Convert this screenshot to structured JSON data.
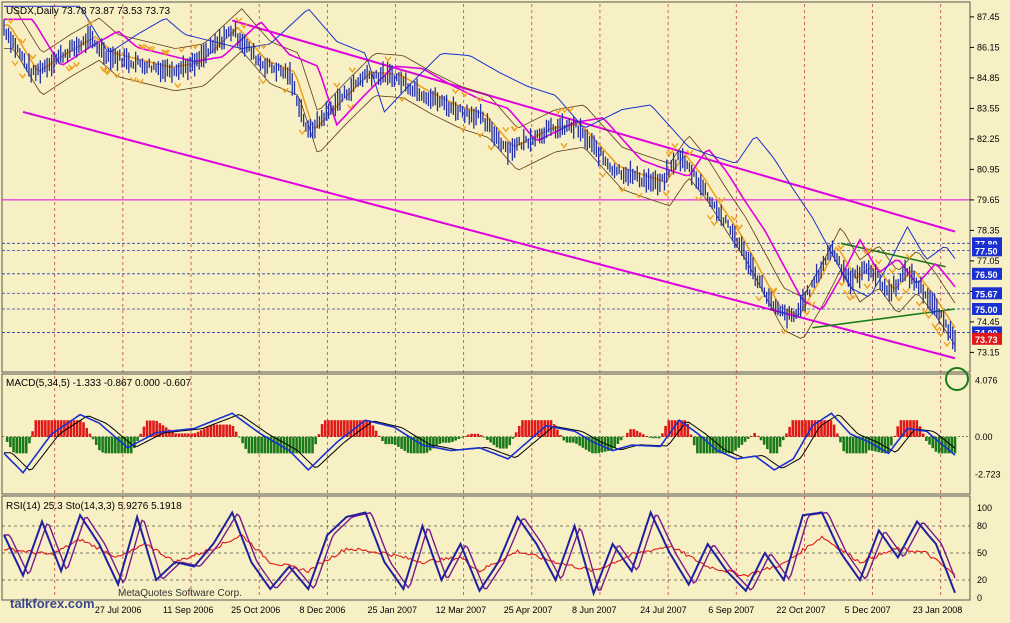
{
  "chart_data": [
    {
      "type": "line",
      "panel": "price",
      "header": "USDX,Daily  73.78 73.87 73.53 73.73",
      "symbol": "USDX",
      "timeframe": "Daily",
      "ohlc": {
        "open": 73.78,
        "high": 73.87,
        "low": 73.53,
        "close": 73.73
      },
      "y_ticks": [
        "87.45",
        "86.15",
        "84.85",
        "83.55",
        "82.25",
        "80.95",
        "79.65",
        "78.35",
        "77.05",
        "75.75",
        "74.45",
        "73.15"
      ],
      "ylim": [
        72.4,
        88.0
      ],
      "price_labels": [
        {
          "text": "77.80",
          "value": 77.8
        },
        {
          "text": "77.50",
          "value": 77.5
        },
        {
          "text": "76.50",
          "value": 76.5
        },
        {
          "text": "75.67",
          "value": 75.67
        },
        {
          "text": "75.00",
          "value": 75.0
        },
        {
          "text": "74.00",
          "value": 74.0
        },
        {
          "text": "73.73",
          "value": 73.73
        }
      ],
      "horizontal_levels": [
        79.65,
        77.8,
        77.5,
        76.5,
        75.67,
        75.0,
        74.0
      ],
      "close_path": [
        [
          0,
          87.0
        ],
        [
          0.03,
          85.0
        ],
        [
          0.06,
          85.8
        ],
        [
          0.09,
          86.5
        ],
        [
          0.11,
          85.8
        ],
        [
          0.14,
          85.5
        ],
        [
          0.17,
          85.2
        ],
        [
          0.2,
          85.4
        ],
        [
          0.24,
          86.9
        ],
        [
          0.27,
          85.5
        ],
        [
          0.3,
          85.0
        ],
        [
          0.32,
          82.5
        ],
        [
          0.35,
          83.8
        ],
        [
          0.38,
          85.0
        ],
        [
          0.41,
          84.9
        ],
        [
          0.44,
          84.2
        ],
        [
          0.47,
          83.6
        ],
        [
          0.5,
          83.2
        ],
        [
          0.53,
          81.8
        ],
        [
          0.57,
          82.6
        ],
        [
          0.6,
          82.8
        ],
        [
          0.62,
          81.9
        ],
        [
          0.64,
          81.0
        ],
        [
          0.66,
          80.7
        ],
        [
          0.69,
          80.3
        ],
        [
          0.71,
          81.5
        ],
        [
          0.73,
          80.5
        ],
        [
          0.75,
          79.2
        ],
        [
          0.77,
          78.0
        ],
        [
          0.79,
          76.5
        ],
        [
          0.81,
          75.0
        ],
        [
          0.83,
          74.6
        ],
        [
          0.85,
          76.0
        ],
        [
          0.87,
          77.6
        ],
        [
          0.89,
          76.2
        ],
        [
          0.91,
          76.8
        ],
        [
          0.93,
          75.7
        ],
        [
          0.95,
          76.6
        ],
        [
          0.97,
          75.6
        ],
        [
          1.0,
          73.73
        ]
      ]
    },
    {
      "type": "bar",
      "panel": "macd",
      "header": "MACD(5,34,5) -1.333 -0.867 0.000 -0.607",
      "params": [
        5,
        34,
        5
      ],
      "values_shown": [
        -1.333,
        -0.867,
        0.0,
        -0.607
      ],
      "y_ticks": [
        "4.076",
        "0.00",
        "-2.723"
      ],
      "ylim": [
        -4.0,
        4.4
      ],
      "line_path": [
        [
          0,
          -1.2
        ],
        [
          0.02,
          -2.6
        ],
        [
          0.05,
          0.2
        ],
        [
          0.08,
          1.6
        ],
        [
          0.1,
          1.0
        ],
        [
          0.13,
          -0.8
        ],
        [
          0.16,
          0.3
        ],
        [
          0.2,
          0.6
        ],
        [
          0.24,
          1.7
        ],
        [
          0.27,
          0.2
        ],
        [
          0.3,
          -1.0
        ],
        [
          0.32,
          -2.4
        ],
        [
          0.35,
          -0.4
        ],
        [
          0.38,
          1.2
        ],
        [
          0.41,
          0.7
        ],
        [
          0.44,
          -0.6
        ],
        [
          0.47,
          -1.0
        ],
        [
          0.5,
          -0.8
        ],
        [
          0.53,
          -1.6
        ],
        [
          0.57,
          0.8
        ],
        [
          0.6,
          0.4
        ],
        [
          0.62,
          -0.4
        ],
        [
          0.64,
          -1.0
        ],
        [
          0.66,
          -0.6
        ],
        [
          0.69,
          -0.7
        ],
        [
          0.71,
          1.2
        ],
        [
          0.73,
          0.2
        ],
        [
          0.75,
          -1.0
        ],
        [
          0.77,
          -1.6
        ],
        [
          0.79,
          -1.4
        ],
        [
          0.81,
          -2.4
        ],
        [
          0.83,
          -1.6
        ],
        [
          0.85,
          0.8
        ],
        [
          0.87,
          1.7
        ],
        [
          0.89,
          0.2
        ],
        [
          0.91,
          -0.4
        ],
        [
          0.93,
          -1.2
        ],
        [
          0.95,
          0.6
        ],
        [
          0.97,
          0.4
        ],
        [
          1.0,
          -1.333
        ]
      ]
    },
    {
      "type": "line",
      "panel": "rsi_stoch",
      "header": "RSI(14) 25.3   Sto(14,3,3) 5.9276 5.1918",
      "y_ticks": [
        "100",
        "80",
        "50",
        "20",
        "0"
      ],
      "ylim": [
        0,
        100
      ],
      "reference_levels": [
        80,
        50,
        20
      ],
      "stoch_path": [
        [
          0,
          70
        ],
        [
          0.02,
          25
        ],
        [
          0.04,
          85
        ],
        [
          0.06,
          30
        ],
        [
          0.08,
          92
        ],
        [
          0.1,
          60
        ],
        [
          0.12,
          15
        ],
        [
          0.14,
          90
        ],
        [
          0.16,
          20
        ],
        [
          0.18,
          40
        ],
        [
          0.2,
          35
        ],
        [
          0.22,
          60
        ],
        [
          0.24,
          95
        ],
        [
          0.26,
          40
        ],
        [
          0.28,
          10
        ],
        [
          0.3,
          35
        ],
        [
          0.32,
          10
        ],
        [
          0.34,
          70
        ],
        [
          0.36,
          90
        ],
        [
          0.38,
          95
        ],
        [
          0.4,
          40
        ],
        [
          0.42,
          10
        ],
        [
          0.44,
          80
        ],
        [
          0.46,
          20
        ],
        [
          0.48,
          60
        ],
        [
          0.5,
          8
        ],
        [
          0.52,
          40
        ],
        [
          0.54,
          90
        ],
        [
          0.56,
          60
        ],
        [
          0.58,
          20
        ],
        [
          0.6,
          80
        ],
        [
          0.62,
          5
        ],
        [
          0.64,
          60
        ],
        [
          0.66,
          30
        ],
        [
          0.68,
          95
        ],
        [
          0.7,
          50
        ],
        [
          0.72,
          15
        ],
        [
          0.74,
          60
        ],
        [
          0.76,
          30
        ],
        [
          0.78,
          8
        ],
        [
          0.8,
          50
        ],
        [
          0.82,
          20
        ],
        [
          0.84,
          92
        ],
        [
          0.86,
          95
        ],
        [
          0.88,
          50
        ],
        [
          0.9,
          20
        ],
        [
          0.92,
          75
        ],
        [
          0.94,
          45
        ],
        [
          0.96,
          85
        ],
        [
          0.98,
          60
        ],
        [
          1.0,
          5.9
        ]
      ],
      "rsi_path": [
        [
          0,
          55
        ],
        [
          0.05,
          48
        ],
        [
          0.08,
          65
        ],
        [
          0.12,
          45
        ],
        [
          0.15,
          60
        ],
        [
          0.18,
          40
        ],
        [
          0.22,
          55
        ],
        [
          0.25,
          70
        ],
        [
          0.28,
          40
        ],
        [
          0.32,
          30
        ],
        [
          0.36,
          55
        ],
        [
          0.4,
          50
        ],
        [
          0.44,
          40
        ],
        [
          0.48,
          45
        ],
        [
          0.5,
          30
        ],
        [
          0.54,
          52
        ],
        [
          0.58,
          40
        ],
        [
          0.62,
          30
        ],
        [
          0.66,
          48
        ],
        [
          0.7,
          58
        ],
        [
          0.74,
          35
        ],
        [
          0.78,
          25
        ],
        [
          0.82,
          38
        ],
        [
          0.86,
          68
        ],
        [
          0.9,
          40
        ],
        [
          0.94,
          55
        ],
        [
          0.97,
          50
        ],
        [
          1.0,
          25.3
        ]
      ]
    }
  ],
  "x_axis": {
    "date_labels": [
      "27 Jul 2006",
      "11 Sep 2006",
      "25 Oct 2006",
      "8 Dec 2006",
      "25 Jan 2007",
      "12 Mar 2007",
      "25 Apr 2007",
      "8 Jun 2007",
      "24 Jul 2007",
      "6 Sep 2007",
      "22 Oct 2007",
      "5 Dec 2007",
      "23 Jan 2008"
    ]
  },
  "overlay_text": {
    "publisher": "MetaQuotes Software Corp.",
    "watermark": "talkforex.com"
  },
  "colors": {
    "background": "#f7f0c4",
    "price_bars": "#2430a8",
    "bollinger": "#5a3a1a",
    "trend_magenta": "#e000e0",
    "moving_avg_orange": "#f0a020",
    "moving_avg_blue": "#1a30d0",
    "macd_positive": "#e01818",
    "macd_negative": "#1a7a1a",
    "macd_line": "#1a30d0",
    "rsi": "#e01818",
    "stoch": "#2020a0",
    "label_box": "#1a30d0",
    "label_close_box": "#e01818",
    "wedge_green": "#1a7a1a",
    "grid_dash": "#b44"
  }
}
